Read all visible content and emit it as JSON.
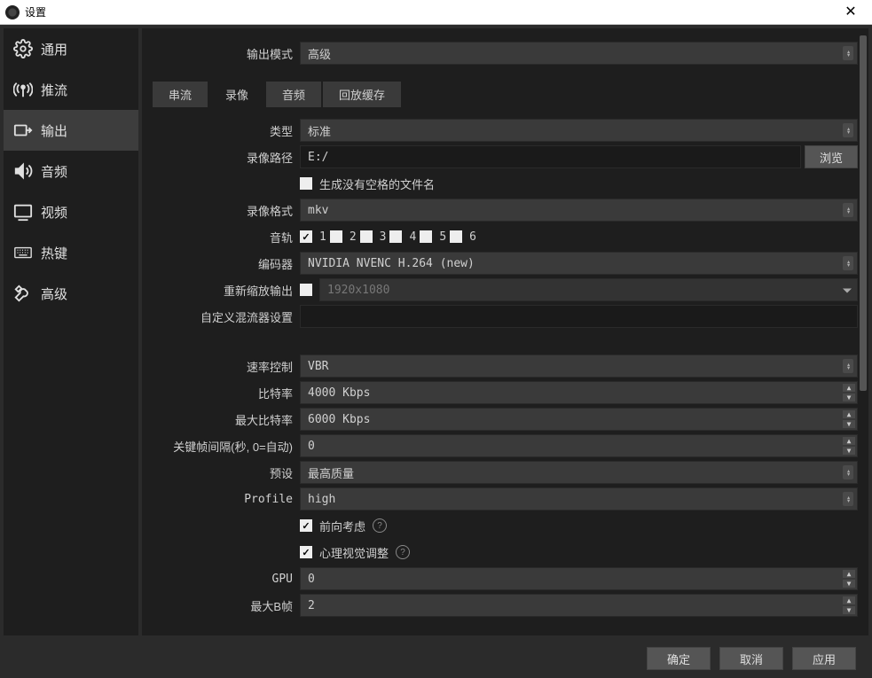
{
  "window": {
    "title": "设置"
  },
  "sidebar": {
    "items": [
      {
        "label": "通用"
      },
      {
        "label": "推流"
      },
      {
        "label": "输出"
      },
      {
        "label": "音频"
      },
      {
        "label": "视频"
      },
      {
        "label": "热键"
      },
      {
        "label": "高级"
      }
    ]
  },
  "output_mode": {
    "label": "输出模式",
    "value": "高级"
  },
  "tabs": {
    "streaming": "串流",
    "recording": "录像",
    "audio": "音频",
    "replay": "回放缓存"
  },
  "recording": {
    "type_label": "类型",
    "type_value": "标准",
    "path_label": "录像路径",
    "path_value": "E:/",
    "browse": "浏览",
    "no_space_label": "生成没有空格的文件名",
    "format_label": "录像格式",
    "format_value": "mkv",
    "tracks_label": "音轨",
    "tracks": [
      "1",
      "2",
      "3",
      "4",
      "5",
      "6"
    ],
    "encoder_label": "编码器",
    "encoder_value": "NVIDIA NVENC H.264 (new)",
    "rescale_label": "重新缩放输出",
    "rescale_value": "1920x1080",
    "custom_mux_label": "自定义混流器设置"
  },
  "encoder": {
    "rate_control_label": "速率控制",
    "rate_control_value": "VBR",
    "bitrate_label": "比特率",
    "bitrate_value": "4000 Kbps",
    "max_bitrate_label": "最大比特率",
    "max_bitrate_value": "6000 Kbps",
    "keyframe_label": "关键帧间隔(秒, 0=自动)",
    "keyframe_value": "0",
    "preset_label": "预设",
    "preset_value": "最高质量",
    "profile_label": "Profile",
    "profile_value": "high",
    "lookahead_label": "前向考虑",
    "psycho_label": "心理视觉调整",
    "gpu_label": "GPU",
    "gpu_value": "0",
    "bframes_label": "最大B帧",
    "bframes_value": "2"
  },
  "buttons": {
    "ok": "确定",
    "cancel": "取消",
    "apply": "应用"
  }
}
